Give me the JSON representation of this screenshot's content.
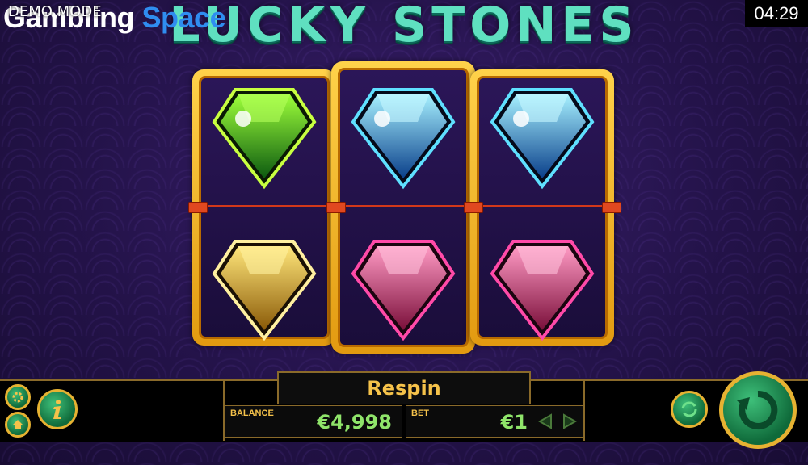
{
  "watermark": {
    "word1": "Gambling",
    "word2": "Space"
  },
  "demo_mode": "DEMO MODE",
  "title": "LUCKY STONES",
  "clock": "04:29",
  "reels": [
    {
      "top_gem": "green",
      "bottom_gem": "yellow"
    },
    {
      "top_gem": "blue",
      "bottom_gem": "pink"
    },
    {
      "top_gem": "blue",
      "bottom_gem": "pink"
    }
  ],
  "gem_colors": {
    "green": [
      "#9dff3a",
      "#2db01a",
      "#0c5a10"
    ],
    "yellow": [
      "#ffe67a",
      "#f0a81a",
      "#8a5a08"
    ],
    "blue": [
      "#a6f0ff",
      "#2b9fe6",
      "#0a3f8a"
    ],
    "pink": [
      "#ff9ac4",
      "#e8306a",
      "#7a0f3a"
    ]
  },
  "footer": {
    "respin_label": "Respin",
    "balance_label": "BALANCE",
    "balance_value": "€4,998",
    "bet_label": "BET",
    "bet_value": "€1"
  },
  "icons": {
    "settings": "gear-icon",
    "home": "home-icon",
    "info": "info-icon",
    "autoplay": "autoplay-icon",
    "spin": "spin-icon",
    "bet_down": "triangle-left-icon",
    "bet_up": "triangle-right-icon"
  }
}
